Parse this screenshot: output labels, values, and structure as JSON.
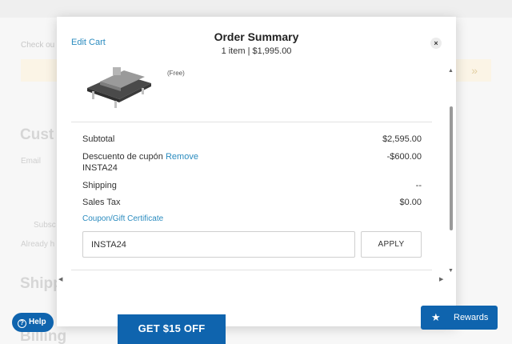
{
  "background": {
    "checkout_text": "Check ou",
    "banner_arrows": "»",
    "heading_customer": "Cust",
    "label_email": "Email",
    "label_subscribe": "Subsc",
    "label_already": "Already h",
    "heading_shipping": "Shipp",
    "heading_billing": "Billing"
  },
  "modal": {
    "edit_cart": "Edit Cart",
    "title": "Order Summary",
    "subtitle": "1 item | $1,995.00",
    "close_symbol": "×",
    "product": {
      "price_tag": "(Free)"
    },
    "totals": {
      "subtotal_label": "Subtotal",
      "subtotal_value": "$2,595.00",
      "discount_label": "Descuento de cupón",
      "discount_remove": "Remove",
      "discount_code": "INSTA24",
      "discount_value": "-$600.00",
      "shipping_label": "Shipping",
      "shipping_value": "--",
      "tax_label": "Sales Tax",
      "tax_value": "$0.00"
    },
    "coupon": {
      "link": "Coupon/Gift Certificate",
      "input_value": "INSTA24",
      "apply_label": "APPLY"
    },
    "scroll": {
      "up": "▲",
      "down": "▼",
      "left": "◀",
      "right": "▶"
    }
  },
  "floating": {
    "help_label": "Help",
    "help_icon": "?",
    "offer_label": "GET $15 OFF",
    "rewards_label": "Rewards",
    "rewards_icon": "★"
  },
  "colors": {
    "accent_blue": "#0f64ae",
    "link_blue": "#2a8bbf"
  }
}
